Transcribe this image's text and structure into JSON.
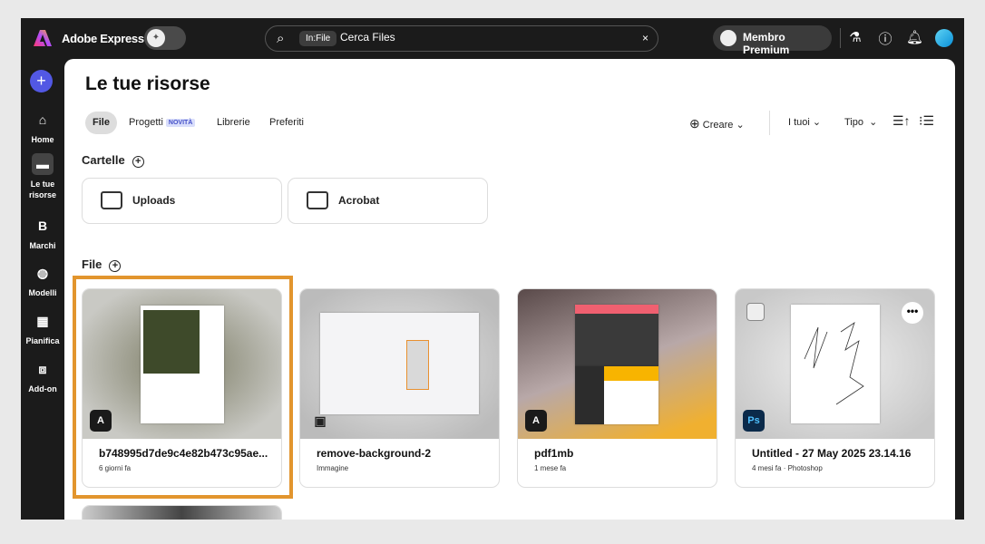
{
  "app": {
    "name": "Adobe Express"
  },
  "search": {
    "scope": "In:File",
    "value": "Cerca Files",
    "clear": "×"
  },
  "header": {
    "premium": "Membro Premium"
  },
  "sidebar": {
    "items": [
      {
        "label": "Home",
        "icon": "⌂"
      },
      {
        "label": "Le tue risorse",
        "icon": "▬"
      },
      {
        "label": "Marchi",
        "icon": "B"
      },
      {
        "label": "Modelli",
        "icon": "◍"
      },
      {
        "label": "Pianifica",
        "icon": "▦"
      },
      {
        "label": "Add-on",
        "icon": "⧈"
      }
    ]
  },
  "page": {
    "title": "Le tue risorse"
  },
  "tabs": [
    {
      "label": "File"
    },
    {
      "label": "Progetti",
      "badge": "NOVITÀ"
    },
    {
      "label": "Librerie"
    },
    {
      "label": "Preferiti"
    }
  ],
  "toolbar": {
    "create": "Creare",
    "owner": "I tuoi",
    "type": "Tipo"
  },
  "folders_section": {
    "title": "Cartelle",
    "items": [
      "Uploads",
      "Acrobat"
    ]
  },
  "files_section": {
    "title": "File",
    "items": [
      {
        "title": "b748995d7de9c4e82b473c95ae...",
        "meta": "6 giorni fa",
        "app": "Express"
      },
      {
        "title": "remove-background-2",
        "meta": "Immagine",
        "app": "Image"
      },
      {
        "title": "pdf1mb",
        "meta": "1 mese fa",
        "app": "Express"
      },
      {
        "title": "Untitled - 27 May 2025 23.14.16",
        "meta": "4 mesi fa",
        "meta2": "Photoshop",
        "app": "Ps"
      }
    ]
  },
  "colors": {
    "accent": "#5258e4",
    "highlight": "#e2952e",
    "topbar": "#1b1b1b"
  }
}
